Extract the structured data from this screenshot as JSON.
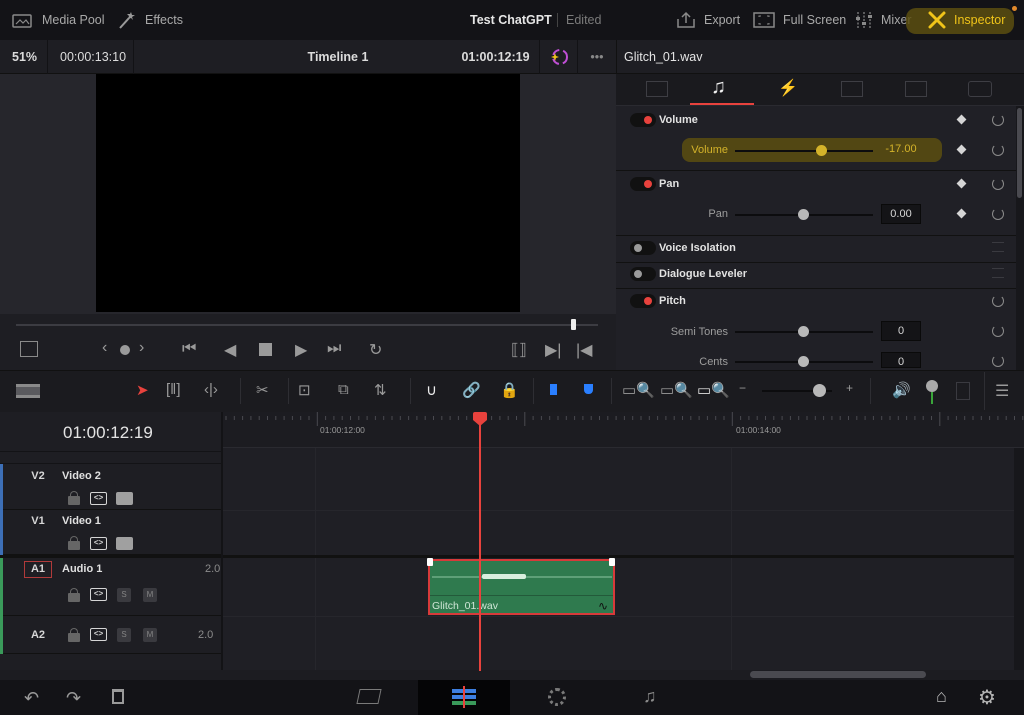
{
  "topbar": {
    "media_pool": "Media Pool",
    "effects": "Effects",
    "project_title": "Test ChatGPT",
    "project_status": "Edited",
    "export": "Export",
    "full_screen": "Full Screen",
    "mixer": "Mixer",
    "inspector": "Inspector",
    "highlight_color": "#5c4f10"
  },
  "viewer": {
    "zoom": "51%",
    "duration": "00:00:13:10",
    "timeline_name": "Timeline 1",
    "timecode": "01:00:12:19",
    "more": "•••",
    "scrub_position_fraction": 0.95
  },
  "inspector": {
    "clip_name": "Glitch_01.wav",
    "tabs": [
      "video-icon",
      "audio-icon",
      "effects-icon",
      "transition-icon",
      "image-icon",
      "file-icon"
    ],
    "active_tab": "audio-icon",
    "sections": {
      "volume": {
        "title": "Volume",
        "enabled": true,
        "param_label": "Volume",
        "value": "-17.00",
        "slider_fraction": 0.7
      },
      "pan": {
        "title": "Pan",
        "enabled": true,
        "param_label": "Pan",
        "value": "0.00",
        "slider_fraction": 0.5
      },
      "voice_isolation": {
        "title": "Voice Isolation",
        "enabled": false
      },
      "dialogue_leveler": {
        "title": "Dialogue Leveler",
        "enabled": false
      },
      "pitch": {
        "title": "Pitch",
        "enabled": true,
        "params": [
          {
            "label": "Semi Tones",
            "value": "0",
            "slider_fraction": 0.5
          },
          {
            "label": "Cents",
            "value": "0",
            "slider_fraction": 0.5
          }
        ]
      }
    },
    "accent_color": "#e8423d",
    "highlight_text_color": "#d4b32a"
  },
  "timeline": {
    "timecode": "01:00:12:19",
    "ruler_labels": [
      "01:00:12:00",
      "01:00:14:00"
    ],
    "zoom_slider_fraction": 0.8,
    "tracks": [
      {
        "id": "V2",
        "name": "Video 2",
        "color": "#3d6fb6"
      },
      {
        "id": "V1",
        "name": "Video 1",
        "color": "#3d6fb6"
      },
      {
        "id": "A1",
        "name": "Audio 1",
        "level": "2.0",
        "color": "#3a9a5a",
        "solo": "S",
        "mute": "M"
      },
      {
        "id": "A2",
        "name": "",
        "level": "2.0",
        "color": "#3a9a5a",
        "solo": "S",
        "mute": "M"
      }
    ],
    "clip": {
      "name": "Glitch_01.wav",
      "color": "#2f7a4e"
    }
  },
  "bottom_nav": {
    "pages": [
      "cut-page-icon",
      "edit-page-icon",
      "color-page-icon",
      "fairlight-page-icon"
    ],
    "active": "edit-page-icon"
  }
}
